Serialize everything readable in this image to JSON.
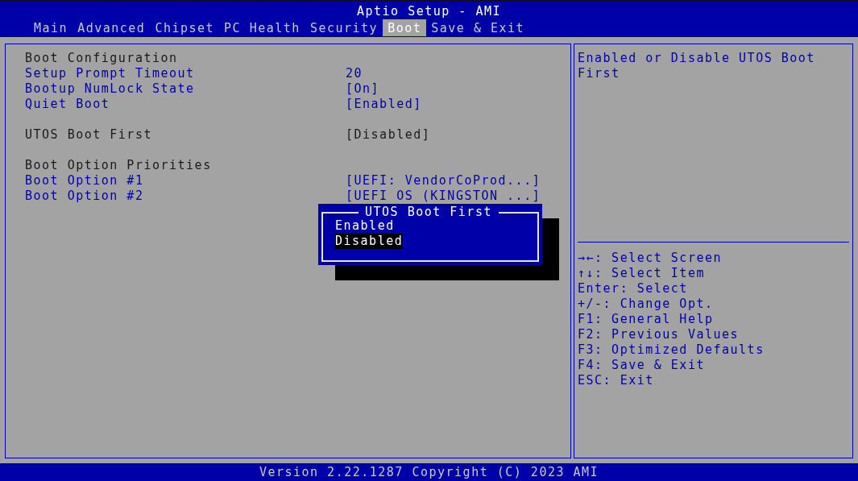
{
  "window": {
    "title": "Aptio Setup - AMI"
  },
  "tabs": [
    {
      "label": "Main",
      "selected": false
    },
    {
      "label": "Advanced",
      "selected": false
    },
    {
      "label": "Chipset",
      "selected": false
    },
    {
      "label": "PC Health",
      "selected": false
    },
    {
      "label": "Security",
      "selected": false
    },
    {
      "label": "Boot",
      "selected": true
    },
    {
      "label": "Save & Exit",
      "selected": false
    }
  ],
  "groups": [
    [
      {
        "kind": "heading",
        "label": "Boot Configuration"
      },
      {
        "kind": "setting",
        "label": "Setup Prompt Timeout",
        "value": "20",
        "selected": false
      },
      {
        "kind": "setting",
        "label": "Bootup NumLock State",
        "value": "[On]",
        "selected": false
      },
      {
        "kind": "setting",
        "label": "Quiet Boot",
        "value": "[Enabled]",
        "selected": false
      }
    ],
    [
      {
        "kind": "setting",
        "label": "UTOS Boot First",
        "value": "[Disabled]",
        "selected": true
      }
    ],
    [
      {
        "kind": "heading",
        "label": "Boot Option Priorities"
      },
      {
        "kind": "setting",
        "label": "Boot Option #1",
        "value": "[UEFI: VendorCoProd...]",
        "selected": false
      },
      {
        "kind": "setting",
        "label": "Boot Option #2",
        "value": "[UEFI OS (KINGSTON ...]",
        "selected": false
      }
    ]
  ],
  "help_text": "Enabled or Disable UTOS Boot First",
  "key_hints": [
    "→←: Select Screen",
    "↑↓: Select Item",
    "Enter: Select",
    "+/-: Change Opt.",
    "F1: General Help",
    "F2: Previous Values",
    "F3: Optimized Defaults",
    "F4: Save & Exit",
    "ESC: Exit"
  ],
  "popup": {
    "title": "UTOS Boot First",
    "options": [
      {
        "label": "Enabled",
        "selected": false
      },
      {
        "label": "Disabled",
        "selected": true
      }
    ]
  },
  "status_bar": "Version 2.22.1287 Copyright (C) 2023 AMI"
}
